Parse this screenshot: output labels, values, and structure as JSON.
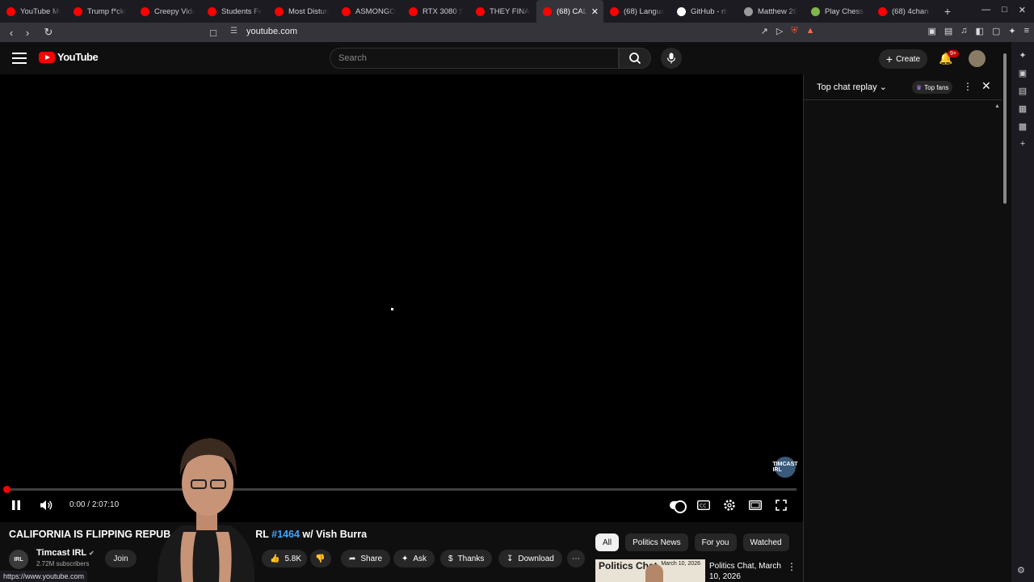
{
  "browser": {
    "tabs": [
      {
        "title": "YouTube Mu",
        "color": "#ff0000",
        "active": false
      },
      {
        "title": "Trump f*cki",
        "color": "#ff0000",
        "active": false
      },
      {
        "title": "Creepy Vide",
        "color": "#ff0000",
        "active": false
      },
      {
        "title": "Students Fe",
        "color": "#ff0000",
        "active": false
      },
      {
        "title": "Most Disturb",
        "color": "#ff0000",
        "active": false
      },
      {
        "title": "ASMONGOL",
        "color": "#ff0000",
        "active": false
      },
      {
        "title": "RTX 3080 Sc",
        "color": "#ff0000",
        "active": false
      },
      {
        "title": "THEY FINAL",
        "color": "#ff0000",
        "active": false
      },
      {
        "title": "(68) CAL",
        "color": "#ff0000",
        "active": true
      },
      {
        "title": "(68) Langua",
        "color": "#ff0000",
        "active": false
      },
      {
        "title": "GitHub - rh",
        "color": "#ffffff",
        "active": false
      },
      {
        "title": "Matthew 26",
        "color": "#9a9a9a",
        "active": false
      },
      {
        "title": "Play Chess O",
        "color": "#81b64c",
        "active": false
      },
      {
        "title": "(68) 4chan S",
        "color": "#ff0000",
        "active": false
      }
    ],
    "new_tab": "+",
    "url": "youtube.com",
    "status_url": "https://www.youtube.com"
  },
  "header": {
    "logo_text": "YouTube",
    "search_placeholder": "Search",
    "create_label": "Create",
    "notif_badge": "9+"
  },
  "player": {
    "current_time": "0:00",
    "duration": "2:07:10",
    "time_sep": " / ",
    "progress_fraction": 0.0,
    "watermark": "TIMCAST IRL"
  },
  "video": {
    "title_start": "CALIFORNIA IS FLIPPING REPUB",
    "title_mid": "RL",
    "title_hashtag": "#1464",
    "title_end": " w/ Vish Burra",
    "channel_name": "Timcast IRL",
    "subscribers": "2.72M subscribers",
    "channel_avatar_text": "IRL",
    "join_label": "Join",
    "likes": "5.8K",
    "share_label": "Share",
    "ask_label": "Ask",
    "thanks_label": "Thanks",
    "download_label": "Download"
  },
  "chat": {
    "title": "Top chat replay",
    "top_fans": "Top fans"
  },
  "recommendations": {
    "chips": [
      "All",
      "Politics News",
      "For you",
      "Watched"
    ],
    "items": [
      {
        "thumb_title": "Politics Chat",
        "thumb_date": "March 10, 2026",
        "title": "Politics Chat, March 10, 2026"
      }
    ]
  },
  "colors": {
    "accent": "#ff0000",
    "link": "#3ea6ff",
    "background": "#0f0f0f"
  }
}
